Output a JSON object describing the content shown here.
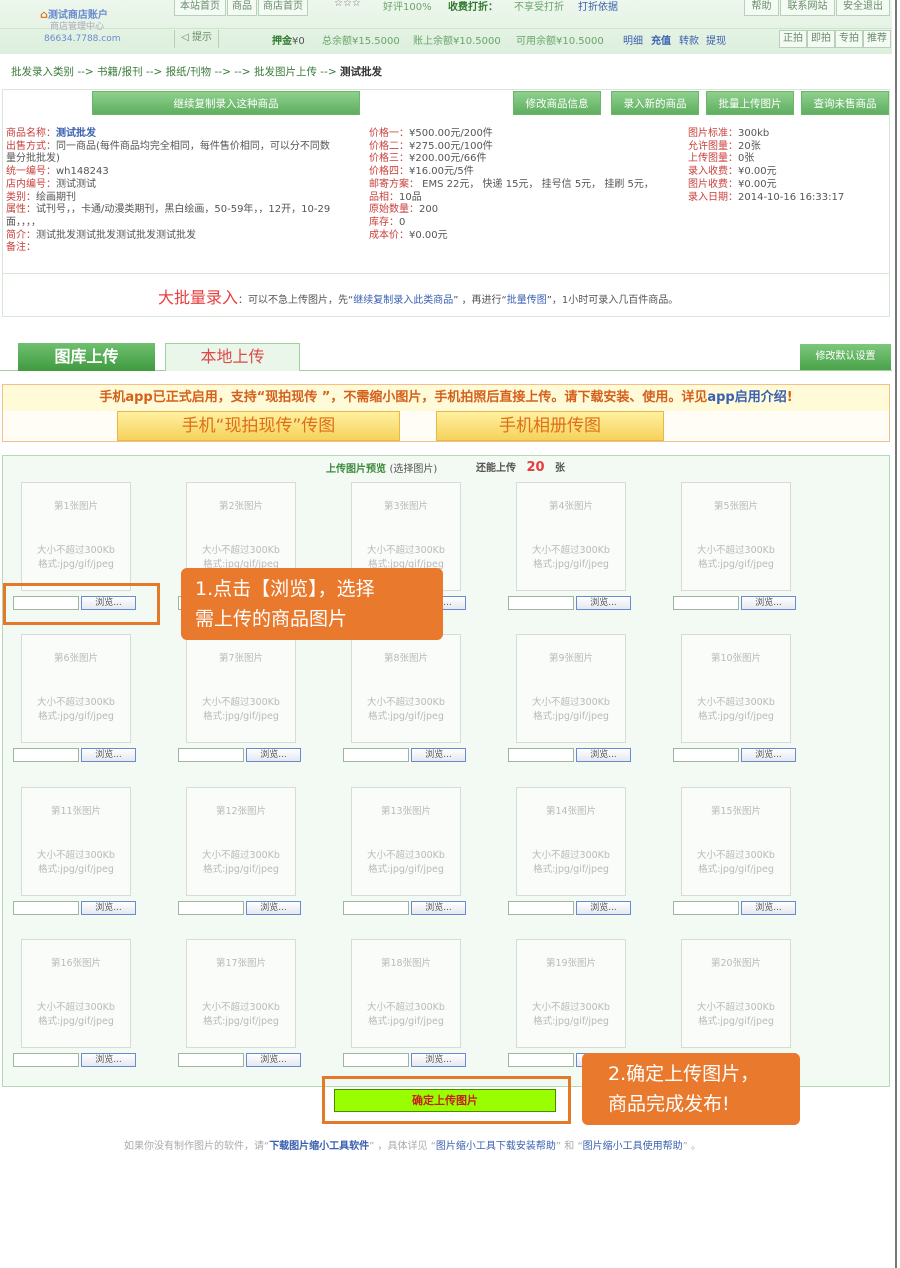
{
  "header": {
    "logo_title": "测试商店账户",
    "logo_subtitle": "商店管理中心",
    "domain": "86634.7788.com",
    "top_buttons": [
      "本站首页",
      "商品",
      "商店首页"
    ],
    "stars": "☆☆☆",
    "rating": "好评100%",
    "discount_label": "收费打折：",
    "discount_status": "不享受打折",
    "discount_link": "打折依据",
    "right_buttons": [
      "帮助",
      "联系网站",
      "安全退出"
    ],
    "notice_label": "提示",
    "deposit_label": "押金",
    "deposit_value": "¥0",
    "total_balance": "总余额¥15.5000",
    "account_balance": "账上余额¥10.5000",
    "usable_balance": "可用余额¥10.5000",
    "detail_link": "明细",
    "recharge_link": "充值",
    "transfer_link": "转款",
    "withdraw_link": "提现",
    "auction_buttons": [
      "正拍",
      "即拍",
      "专拍",
      "推荐"
    ]
  },
  "breadcrumb": {
    "path": "批发录入类别 --> 书籍/报刊 --> 报纸/刊物 --> --> 批发图片上传 -->",
    "current": "测试批发"
  },
  "actions": {
    "continue_copy": "继续复制录入这种商品",
    "edit_info": "修改商品信息",
    "new_product": "录入新的商品",
    "bulk_upload": "批量上传图片",
    "query_unsold": "查询未售商品"
  },
  "product": {
    "col1": [
      {
        "k": "商品名称：",
        "v": "测试批发"
      },
      {
        "k": "出售方式：",
        "v": "同一商品(每件商品均完全相同，每件售价相同，可以分不同数"
      },
      {
        "k": "",
        "v": "量分批批发)"
      },
      {
        "k": "统一编号：",
        "v": "wh148243"
      },
      {
        "k": "店内编号：",
        "v": "测试测试"
      },
      {
        "k": "类别：",
        "v": "绘画期刊"
      },
      {
        "k": "属性：",
        "v": "试刊号，，卡通/动漫类期刊，黑白绘画，50-59年，，12开，10-29"
      },
      {
        "k": "",
        "v": "面，，，，"
      },
      {
        "k": "简介：",
        "v": "测试批发测试批发测试批发测试批发"
      },
      {
        "k": "备注：",
        "v": ""
      }
    ],
    "col2": [
      {
        "k": "价格一：",
        "v": "¥500.00元/200件"
      },
      {
        "k": "价格二：",
        "v": "¥275.00元/100件"
      },
      {
        "k": "价格三：",
        "v": "¥200.00元/66件"
      },
      {
        "k": "价格四：",
        "v": "¥16.00元/5件"
      },
      {
        "k": "邮寄方案：",
        "v": " EMS 22元， 快递 15元， 挂号信 5元， 挂刷 5元，"
      },
      {
        "k": "品相：",
        "v": "10品"
      },
      {
        "k": "原始数量：",
        "v": "200"
      },
      {
        "k": "库存：",
        "v": "0"
      },
      {
        "k": "成本价：",
        "v": "¥0.00元"
      }
    ],
    "col3": [
      {
        "k": "图片标准：",
        "v": "300kb"
      },
      {
        "k": "允许图量：",
        "v": "20张"
      },
      {
        "k": "上传图量：",
        "v": "0张"
      },
      {
        "k": "录入收费：",
        "v": "¥0.00元"
      },
      {
        "k": "图片收费：",
        "v": "¥0.00元"
      },
      {
        "k": "录入日期：",
        "v": "2014-10-16 16:33:17"
      }
    ]
  },
  "bulk_hint": {
    "big": "大批量录入",
    "t1": "：可以不急上传图片，先“",
    "link1": "继续复制录入此类商品",
    "t2": "” ，再进行“",
    "link2": "批量传图",
    "t3": "”，1小时可录入几百件商品。"
  },
  "tabs": {
    "gallery": "图库上传",
    "local": "本地上传",
    "default_settings": "修改默认设置"
  },
  "app_banner": {
    "text": "手机app已正式启用，支持“现拍现传 ”，不需缩小图片，手机拍照后直接上传。请下载安装、使用。详见",
    "link": "app启用介绍",
    "tail": "!",
    "btn_live": "手机“现拍现传”传图",
    "btn_album": "手机相册传图"
  },
  "upload": {
    "preview_label": "上传图片预览",
    "select_label": "(选择图片)",
    "remaining_label": "还能上传",
    "remaining_count": "20",
    "remaining_unit": "张",
    "size_hint": "大小不超过300Kb",
    "format_hint": "格式:jpg/gif/jpeg",
    "browse": "浏览...",
    "slots": [
      "第1张图片",
      "第2张图片",
      "第3张图片",
      "第4张图片",
      "第5张图片",
      "第6张图片",
      "第7张图片",
      "第8张图片",
      "第9张图片",
      "第10张图片",
      "第11张图片",
      "第12张图片",
      "第13张图片",
      "第14张图片",
      "第15张图片",
      "第16张图片",
      "第17张图片",
      "第18张图片",
      "第19张图片",
      "第20张图片"
    ],
    "confirm": "确定上传图片"
  },
  "callouts": {
    "step1_line1": "1.点击【浏览】，选择",
    "step1_line2": "需上传的商品图片",
    "step2_line1": "2.确定上传图片，",
    "step2_line2": "商品完成发布!"
  },
  "footer": {
    "t1": "如果你没有制作图片的软件，请“",
    "link1": "下载图片缩小工具软件",
    "t2": "” ，具体详见 “",
    "link2": "图片缩小工具下载安装帮助",
    "t3": "” 和 “",
    "link3": "图片缩小工具使用帮助",
    "t4": "” 。"
  }
}
